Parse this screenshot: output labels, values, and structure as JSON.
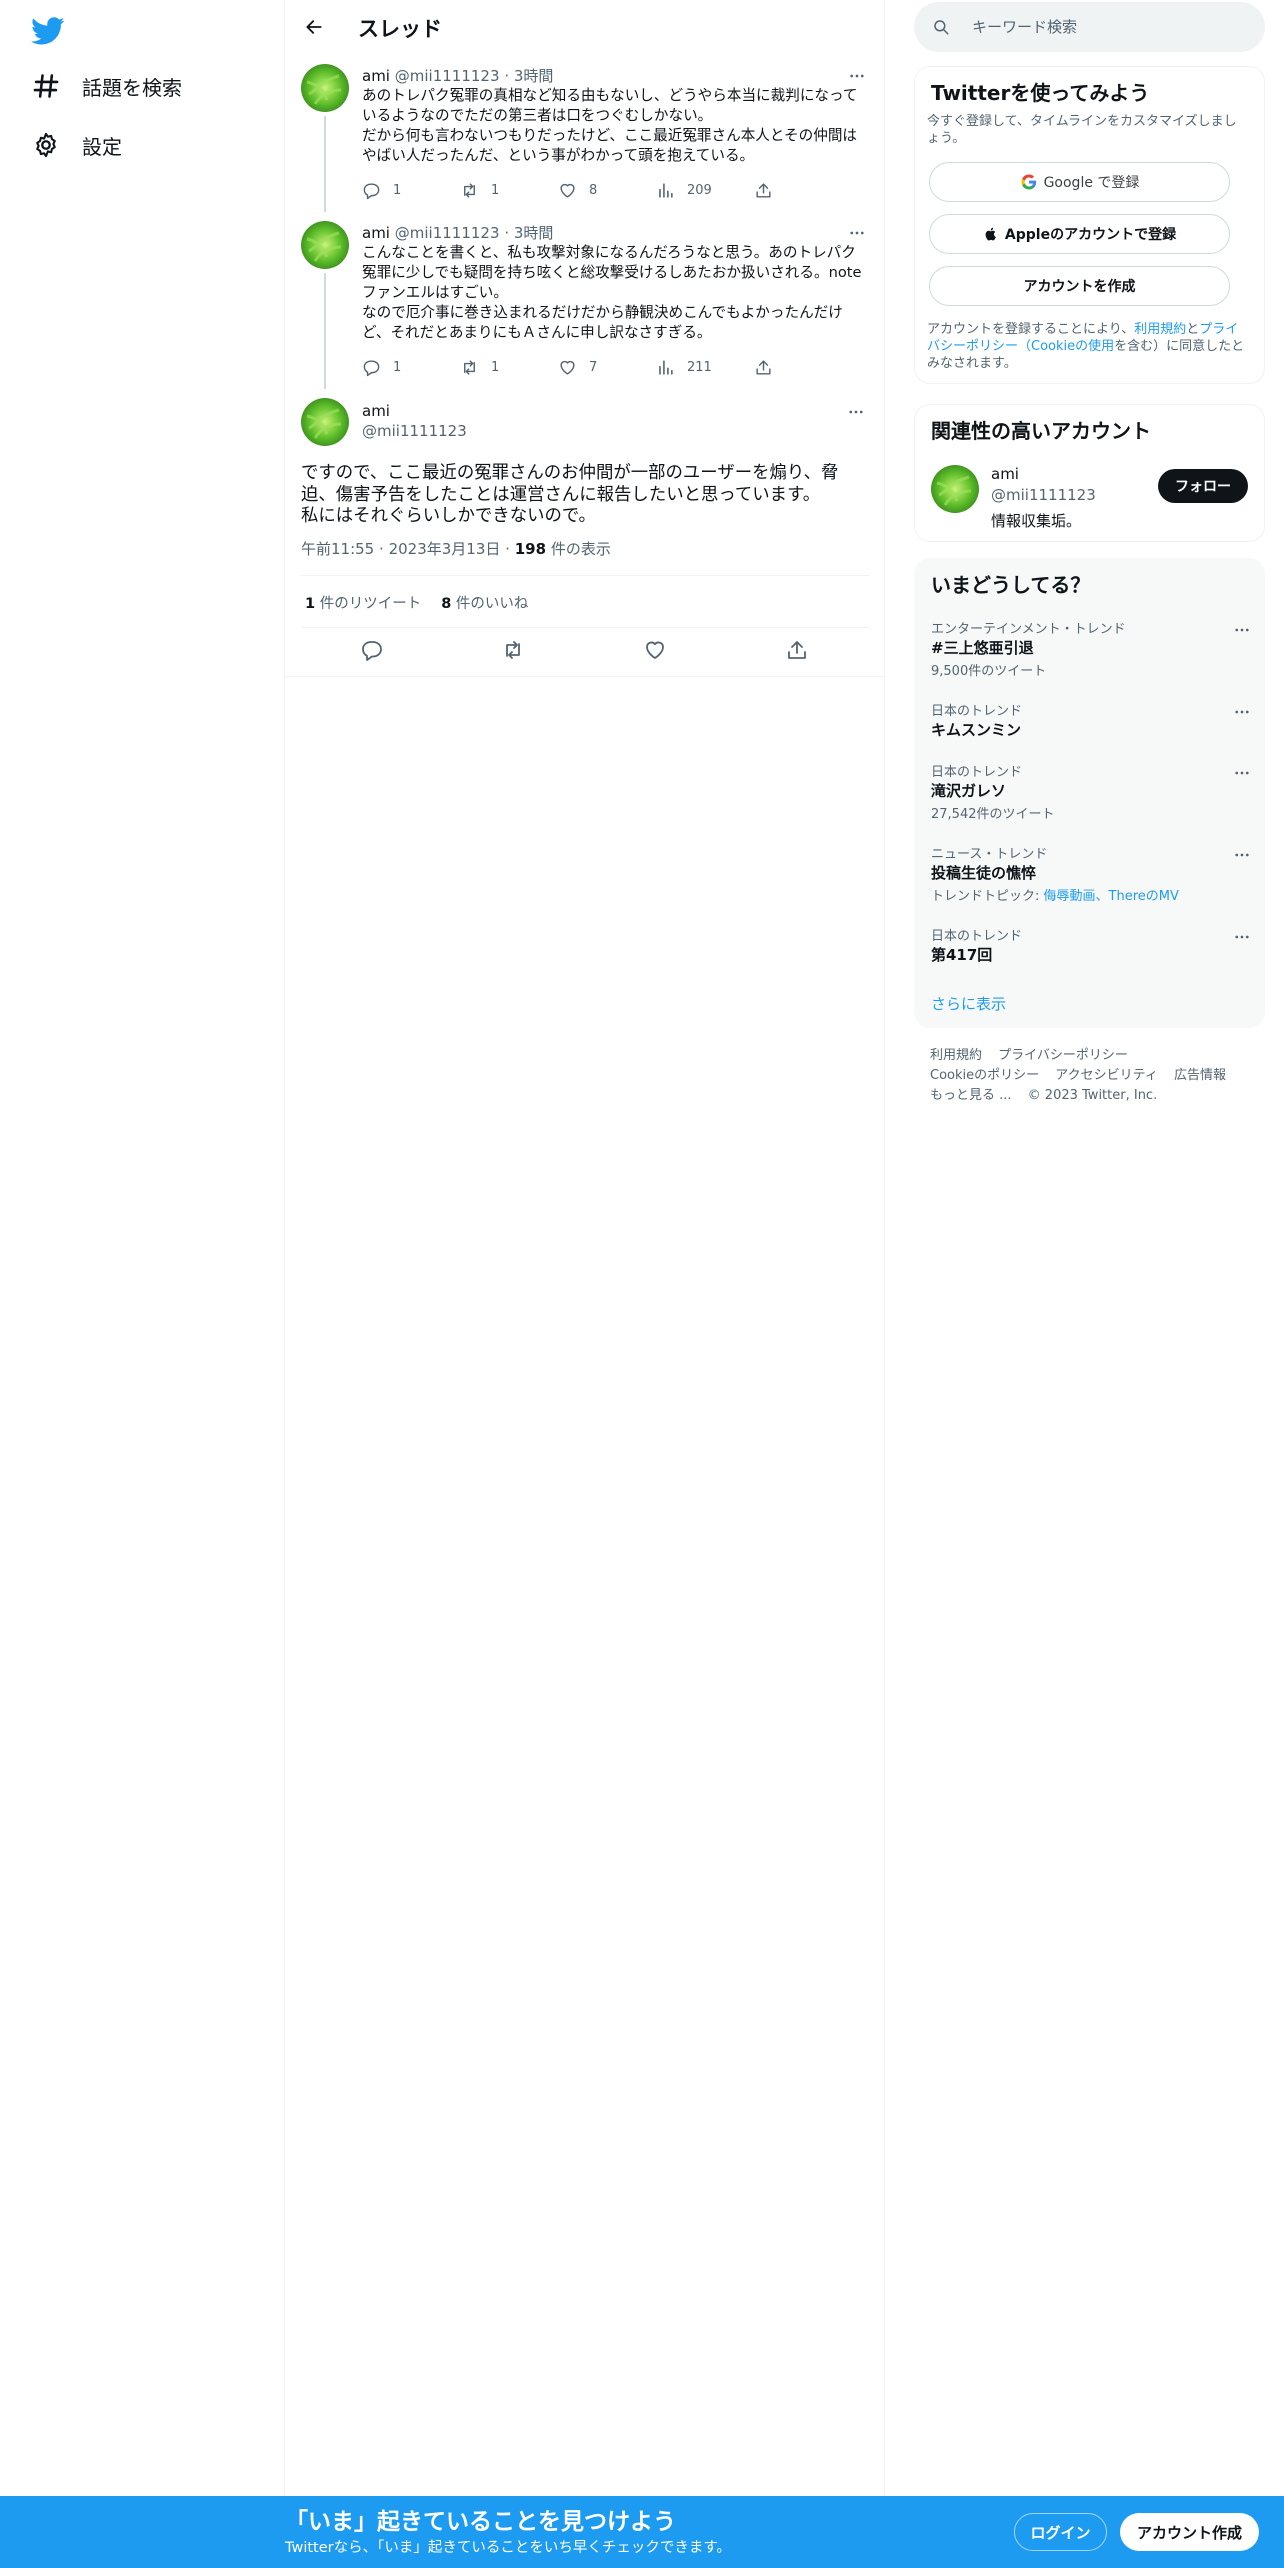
{
  "colors": {
    "accent": "#1d9bf0",
    "text": "#0f1419",
    "muted": "#536471",
    "border": "#eff3f4"
  },
  "nav": {
    "logo_icon": "twitter-bird-icon",
    "items": [
      {
        "label": "話題を検索",
        "icon": "hashtag-icon"
      },
      {
        "label": "設定",
        "icon": "gear-icon"
      }
    ]
  },
  "header": {
    "title": "スレッド",
    "back_icon": "arrow-left-icon"
  },
  "thread": [
    {
      "name": "ami",
      "handle": "@mii1111123",
      "time": "3時間",
      "text": "あのトレパク冤罪の真相など知る由もないし、どうやら本当に裁判になっているようなのでただの第三者は口をつぐむしかない。\nだから何も言わないつもりだったけど、ここ最近冤罪さん本人とその仲間はやばい人だったんだ、という事がわかって頭を抱えている。",
      "replies": "1",
      "retweets": "1",
      "likes": "8",
      "views": "209"
    },
    {
      "name": "ami",
      "handle": "@mii1111123",
      "time": "3時間",
      "text": "こんなことを書くと、私も攻撃対象になるんだろうなと思う。あのトレパク冤罪に少しでも疑問を持ち呟くと総攻撃受けるしあたおか扱いされる。noteファンエルはすごい。\nなので厄介事に巻き込まれるだけだから静観決めこんでもよかったんだけど、それだとあまりにもＡさんに申し訳なさすぎる。",
      "replies": "1",
      "retweets": "1",
      "likes": "7",
      "views": "211"
    }
  ],
  "focus": {
    "name": "ami",
    "handle": "@mii1111123",
    "text": "ですので、ここ最近の冤罪さんのお仲間が一部のユーザーを煽り、脅迫、傷害予告をしたことは運営さんに報告したいと思っています。\n私にはそれぐらいしかできないので。",
    "time": "午前11:55",
    "date": "2023年3月13日",
    "views": "198",
    "views_label": "件の表示",
    "retweets": "1",
    "retweets_label": "件のリツイート",
    "likes": "8",
    "likes_label": "件のいいね"
  },
  "search": {
    "placeholder": "キーワード検索"
  },
  "signup": {
    "title": "Twitterを使ってみよう",
    "subtitle": "今すぐ登録して、タイムラインをカスタマイズしましょう。",
    "google": "Google で登録",
    "apple": "Appleのアカウントで登録",
    "create": "アカウントを作成",
    "legal_pre": "アカウントを登録することにより、",
    "legal_terms": "利用規約",
    "legal_and": "と",
    "legal_privacy": "プライバシーポリシー",
    "legal_cookie": "（Cookieの使用",
    "legal_post": "を含む）に同意したとみなされます。"
  },
  "related": {
    "title": "関連性の高いアカウント",
    "name": "ami",
    "handle": "@mii1111123",
    "bio": "情報収集垢。",
    "follow": "フォロー"
  },
  "trends": {
    "title": "いまどうしてる？",
    "items": [
      {
        "category": "エンターテインメント・トレンド",
        "name": "#三上悠亜引退",
        "count": "9,500件のツイート"
      },
      {
        "category": "日本のトレンド",
        "name": "キムスンミン",
        "count": ""
      },
      {
        "category": "日本のトレンド",
        "name": "滝沢ガレソ",
        "count": "27,542件のツイート"
      },
      {
        "category": "ニュース・トレンド",
        "name": "投稿生徒の憔悴",
        "count_prefix": "トレンドトピック: ",
        "count_link": "侮辱動画、ThereのMV"
      },
      {
        "category": "日本のトレンド",
        "name": "第417回",
        "count": ""
      }
    ],
    "show_more": "さらに表示"
  },
  "footer": {
    "links": [
      "利用規約",
      "プライバシーポリシー",
      "Cookieのポリシー",
      "アクセシビリティ",
      "広告情報",
      "もっと見る ..."
    ],
    "copyright": "© 2023 Twitter, Inc."
  },
  "bottom_bar": {
    "title": "「いま」起きていることを見つけよう",
    "subtitle": "Twitterなら、「いま」起きていることをいち早くチェックできます。",
    "login": "ログイン",
    "signup": "アカウント作成"
  }
}
